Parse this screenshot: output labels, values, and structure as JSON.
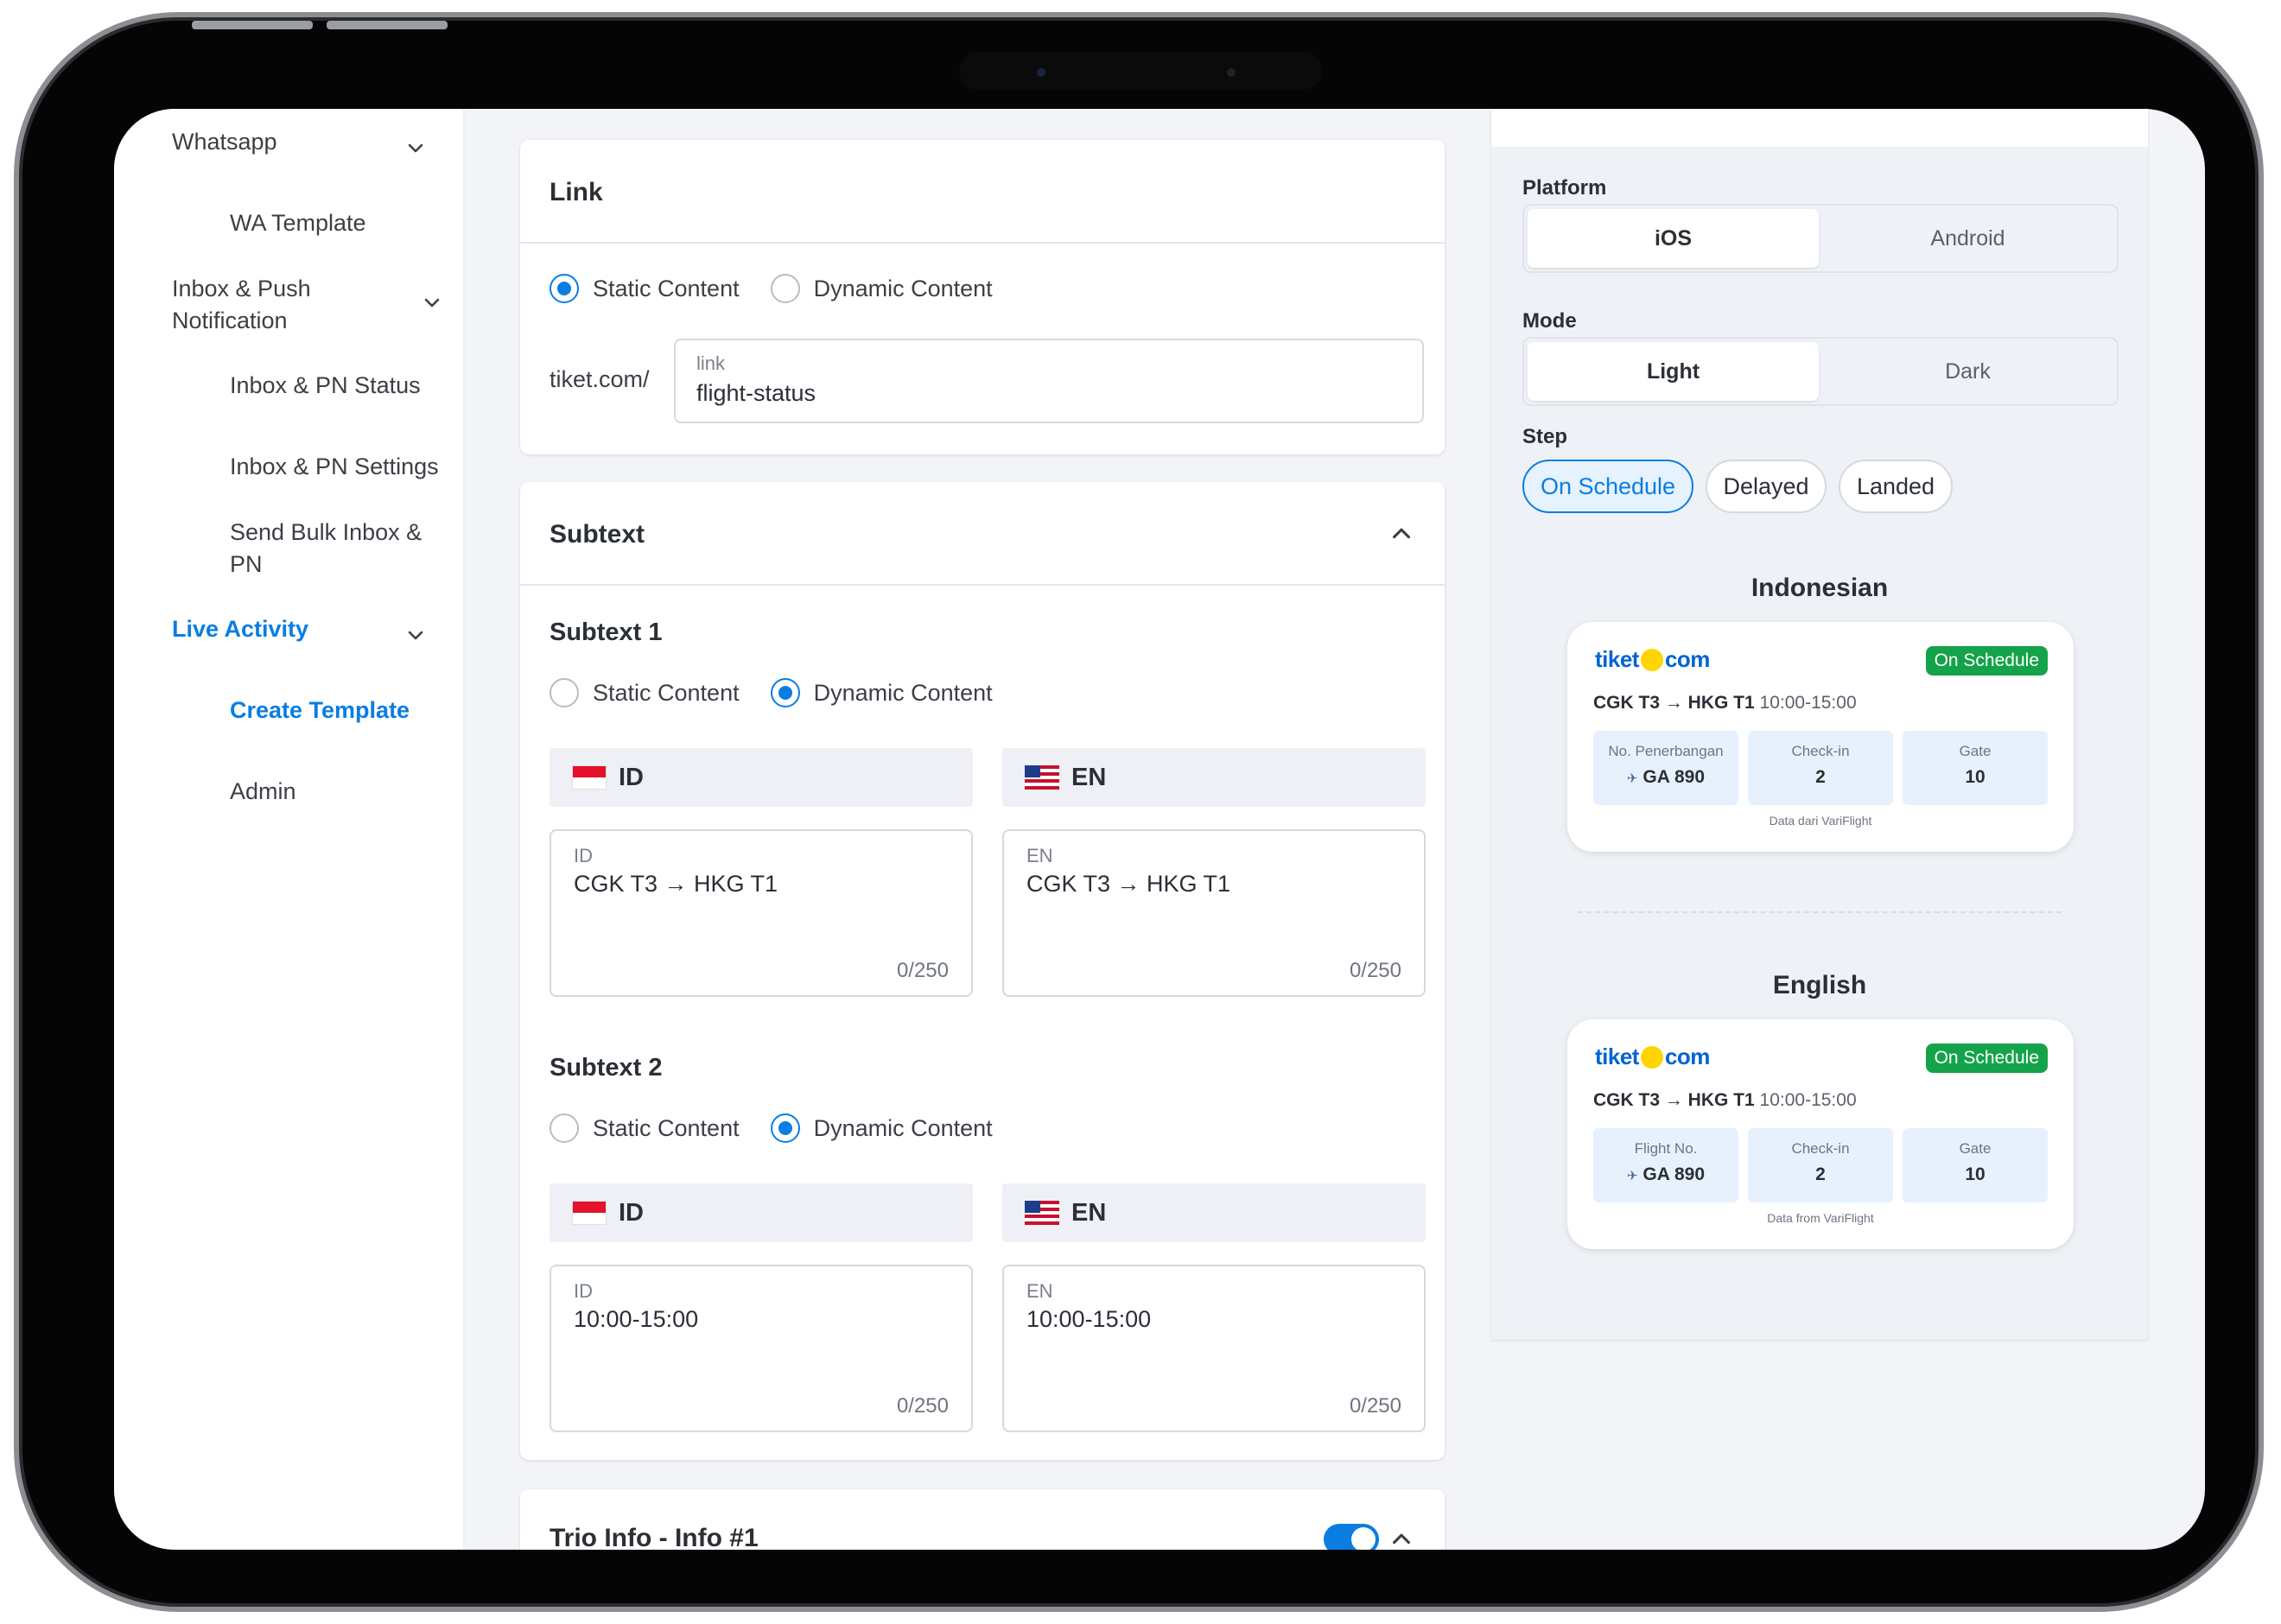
{
  "sidebar": {
    "items": [
      {
        "label": "Whatsapp"
      },
      {
        "label": "WA Template"
      },
      {
        "label": "Inbox & Push Notification"
      },
      {
        "label": "Inbox & PN Status"
      },
      {
        "label": "Inbox & PN Settings"
      },
      {
        "label": "Send Bulk Inbox & PN"
      },
      {
        "label": "Live Activity"
      },
      {
        "label": "Create Template"
      },
      {
        "label": "Admin"
      }
    ]
  },
  "link_card": {
    "title": "Link",
    "static_label": "Static Content",
    "dynamic_label": "Dynamic Content",
    "selected": "Static Content",
    "prefix": "tiket.com/",
    "input_label": "link",
    "input_value": "flight-status"
  },
  "subtext_card": {
    "title": "Subtext",
    "subtext1": {
      "title": "Subtext 1",
      "static_label": "Static Content",
      "dynamic_label": "Dynamic Content",
      "selected": "Dynamic Content",
      "id_tab": "ID",
      "en_tab": "EN",
      "id_label": "ID",
      "id_value": "CGK T3 → HKG T1",
      "id_count": "0/250",
      "en_label": "EN",
      "en_value": "CGK T3 → HKG T1",
      "en_count": "0/250"
    },
    "subtext2": {
      "title": "Subtext 2",
      "static_label": "Static Content",
      "dynamic_label": "Dynamic Content",
      "selected": "Dynamic Content",
      "id_tab": "ID",
      "en_tab": "EN",
      "id_label": "ID",
      "id_value": "10:00-15:00",
      "id_count": "0/250",
      "en_label": "EN",
      "en_value": "10:00-15:00",
      "en_count": "0/250"
    }
  },
  "trio_card": {
    "title": "Trio Info - Info #1",
    "toggle_on": true
  },
  "preview": {
    "platform_label": "Platform",
    "platform_options": [
      "iOS",
      "Android"
    ],
    "platform_selected": "iOS",
    "mode_label": "Mode",
    "mode_options": [
      "Light",
      "Dark"
    ],
    "mode_selected": "Light",
    "step_label": "Step",
    "step_options": [
      "On Schedule",
      "Delayed",
      "Landed"
    ],
    "step_selected": "On Schedule",
    "indonesian": {
      "title": "Indonesian",
      "logo_left": "tiket",
      "logo_right": "com",
      "status": "On Schedule",
      "route": "CGK T3 → HKG T1",
      "time": "10:00-15:00",
      "flight_label": "No. Penerbangan",
      "flight_value": "GA 890",
      "checkin_label": "Check-in",
      "checkin_value": "2",
      "gate_label": "Gate",
      "gate_value": "10",
      "footer": "Data dari VariFlight"
    },
    "english": {
      "title": "English",
      "logo_left": "tiket",
      "logo_right": "com",
      "status": "On Schedule",
      "route": "CGK T3 → HKG T1",
      "time": "10:00-15:00",
      "flight_label": "Flight No.",
      "flight_value": "GA 890",
      "checkin_label": "Check-in",
      "checkin_value": "2",
      "gate_label": "Gate",
      "gate_value": "10",
      "footer": "Data from VariFlight"
    }
  },
  "colors": {
    "accent": "#0a7de3",
    "status_green": "#14a34a",
    "logo_blue": "#0064d2",
    "logo_yellow": "#ffd400"
  },
  "icons": [
    "chevron-down-icon",
    "chevron-up-icon",
    "flag-id-icon",
    "flag-us-icon",
    "plane-icon"
  ]
}
